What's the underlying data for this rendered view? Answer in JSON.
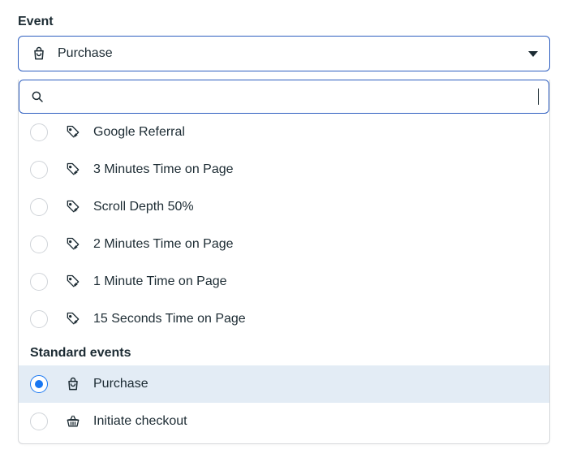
{
  "field_label": "Event",
  "selected_value": "Purchase",
  "search_value": "",
  "custom_events": [
    {
      "label": "Google Referral",
      "icon": "tag-sparkle",
      "selected": false
    },
    {
      "label": "3 Minutes Time on Page",
      "icon": "tag-sparkle",
      "selected": false
    },
    {
      "label": "Scroll Depth 50%",
      "icon": "tag-sparkle",
      "selected": false
    },
    {
      "label": "2 Minutes Time on Page",
      "icon": "tag-sparkle",
      "selected": false
    },
    {
      "label": "1 Minute Time on Page",
      "icon": "tag-sparkle",
      "selected": false
    },
    {
      "label": "15 Seconds Time on Page",
      "icon": "tag-sparkle",
      "selected": false
    }
  ],
  "standard_events_heading": "Standard events",
  "standard_events": [
    {
      "label": "Purchase",
      "icon": "shopping-bag",
      "selected": true
    },
    {
      "label": "Initiate checkout",
      "icon": "basket",
      "selected": false
    }
  ]
}
